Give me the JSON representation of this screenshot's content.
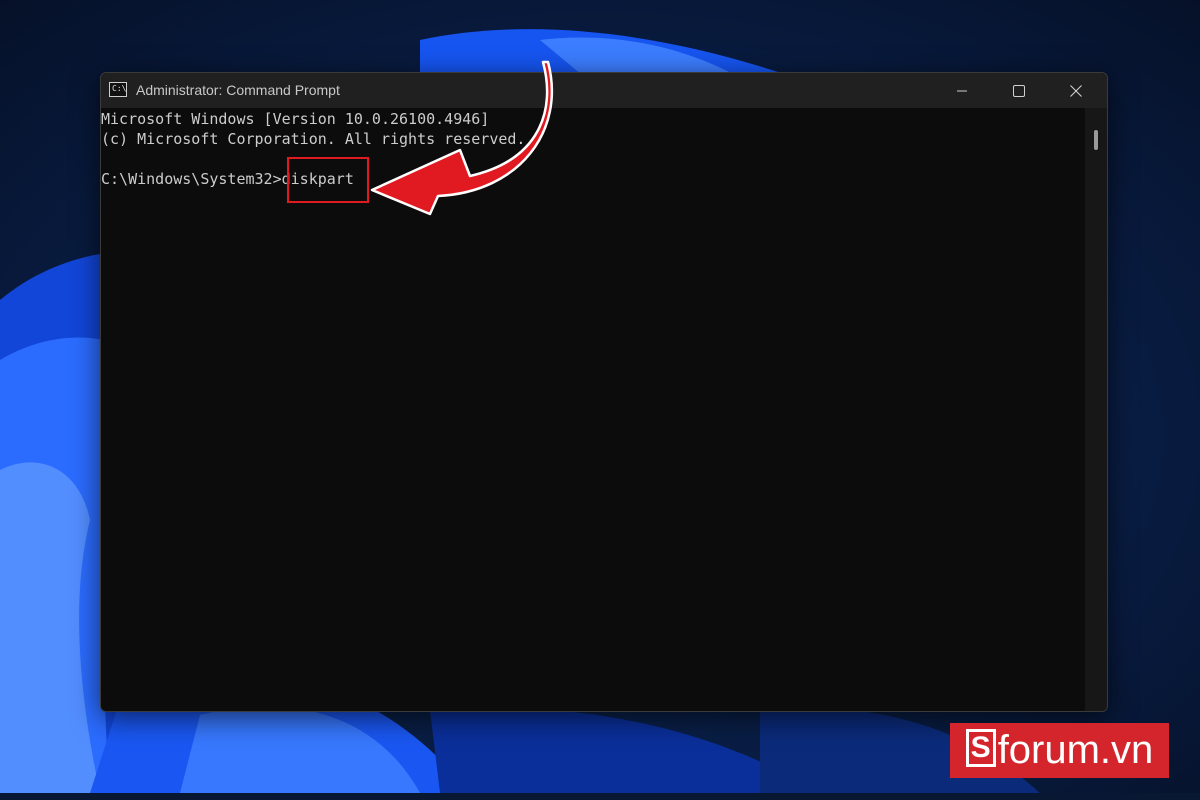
{
  "window": {
    "title": "Administrator: Command Prompt",
    "icon_text": "C:\\",
    "controls": [
      "minimize-icon",
      "maximize-icon",
      "close-icon"
    ]
  },
  "terminal": {
    "lines": [
      "Microsoft Windows [Version 10.0.26100.4946]",
      "(c) Microsoft Corporation. All rights reserved.",
      "",
      "C:\\Windows\\System32>diskpart"
    ],
    "prompt": "C:\\Windows\\System32>",
    "command": "diskpart"
  },
  "annotation": {
    "color": "#e11a22",
    "target": "diskpart"
  },
  "watermark": {
    "logo_letter": "S",
    "text": "forum.vn",
    "background": "#d3252b"
  },
  "colors": {
    "terminal_bg": "#0c0c0c",
    "terminal_text": "#cccccc",
    "titlebar_bg": "#202020",
    "accent_blue": "#1f5fff"
  }
}
